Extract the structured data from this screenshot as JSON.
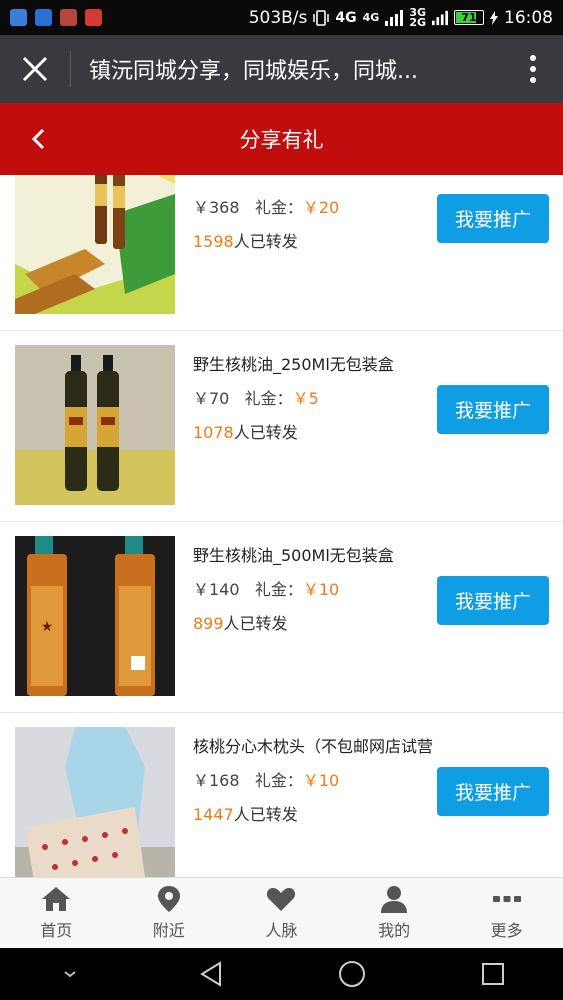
{
  "status_bar": {
    "speed": "503B/s",
    "network_4g": "4G",
    "network_4g_small": "4G",
    "network_3g": "3G",
    "network_2g": "2G",
    "battery": "71",
    "time": "16:08"
  },
  "wechat_bar": {
    "title": "镇沅同城分享，同城娱乐，同城..."
  },
  "header": {
    "title": "分享有礼"
  },
  "products": [
    {
      "name": "",
      "price": "￥368",
      "gift_label": "礼金：",
      "gift": "￥20",
      "share_count": "1598",
      "share_suffix": "人已转发",
      "button": "我要推广"
    },
    {
      "name": "野生核桃油_250Ml无包装盒",
      "price": "￥70",
      "gift_label": "礼金：",
      "gift": "￥5",
      "share_count": "1078",
      "share_suffix": "人已转发",
      "button": "我要推广"
    },
    {
      "name": "野生核桃油_500Ml无包装盒",
      "price": "￥140",
      "gift_label": "礼金：",
      "gift": "￥10",
      "share_count": "899",
      "share_suffix": "人已转发",
      "button": "我要推广"
    },
    {
      "name": "核桃分心木枕头（不包邮网店试营",
      "price": "￥168",
      "gift_label": "礼金：",
      "gift": "￥10",
      "share_count": "1447",
      "share_suffix": "人已转发",
      "button": "我要推广"
    }
  ],
  "bottom_nav": [
    {
      "label": "首页",
      "icon": "home-icon"
    },
    {
      "label": "附近",
      "icon": "location-pin-icon"
    },
    {
      "label": "人脉",
      "icon": "heart-icon"
    },
    {
      "label": "我的",
      "icon": "user-icon"
    },
    {
      "label": "更多",
      "icon": "more-icon"
    }
  ],
  "colors": {
    "header_red": "#c20d0d",
    "button_blue": "#0f9ee3",
    "accent_orange": "#f07b16",
    "wechat_bar": "#393a3f"
  }
}
